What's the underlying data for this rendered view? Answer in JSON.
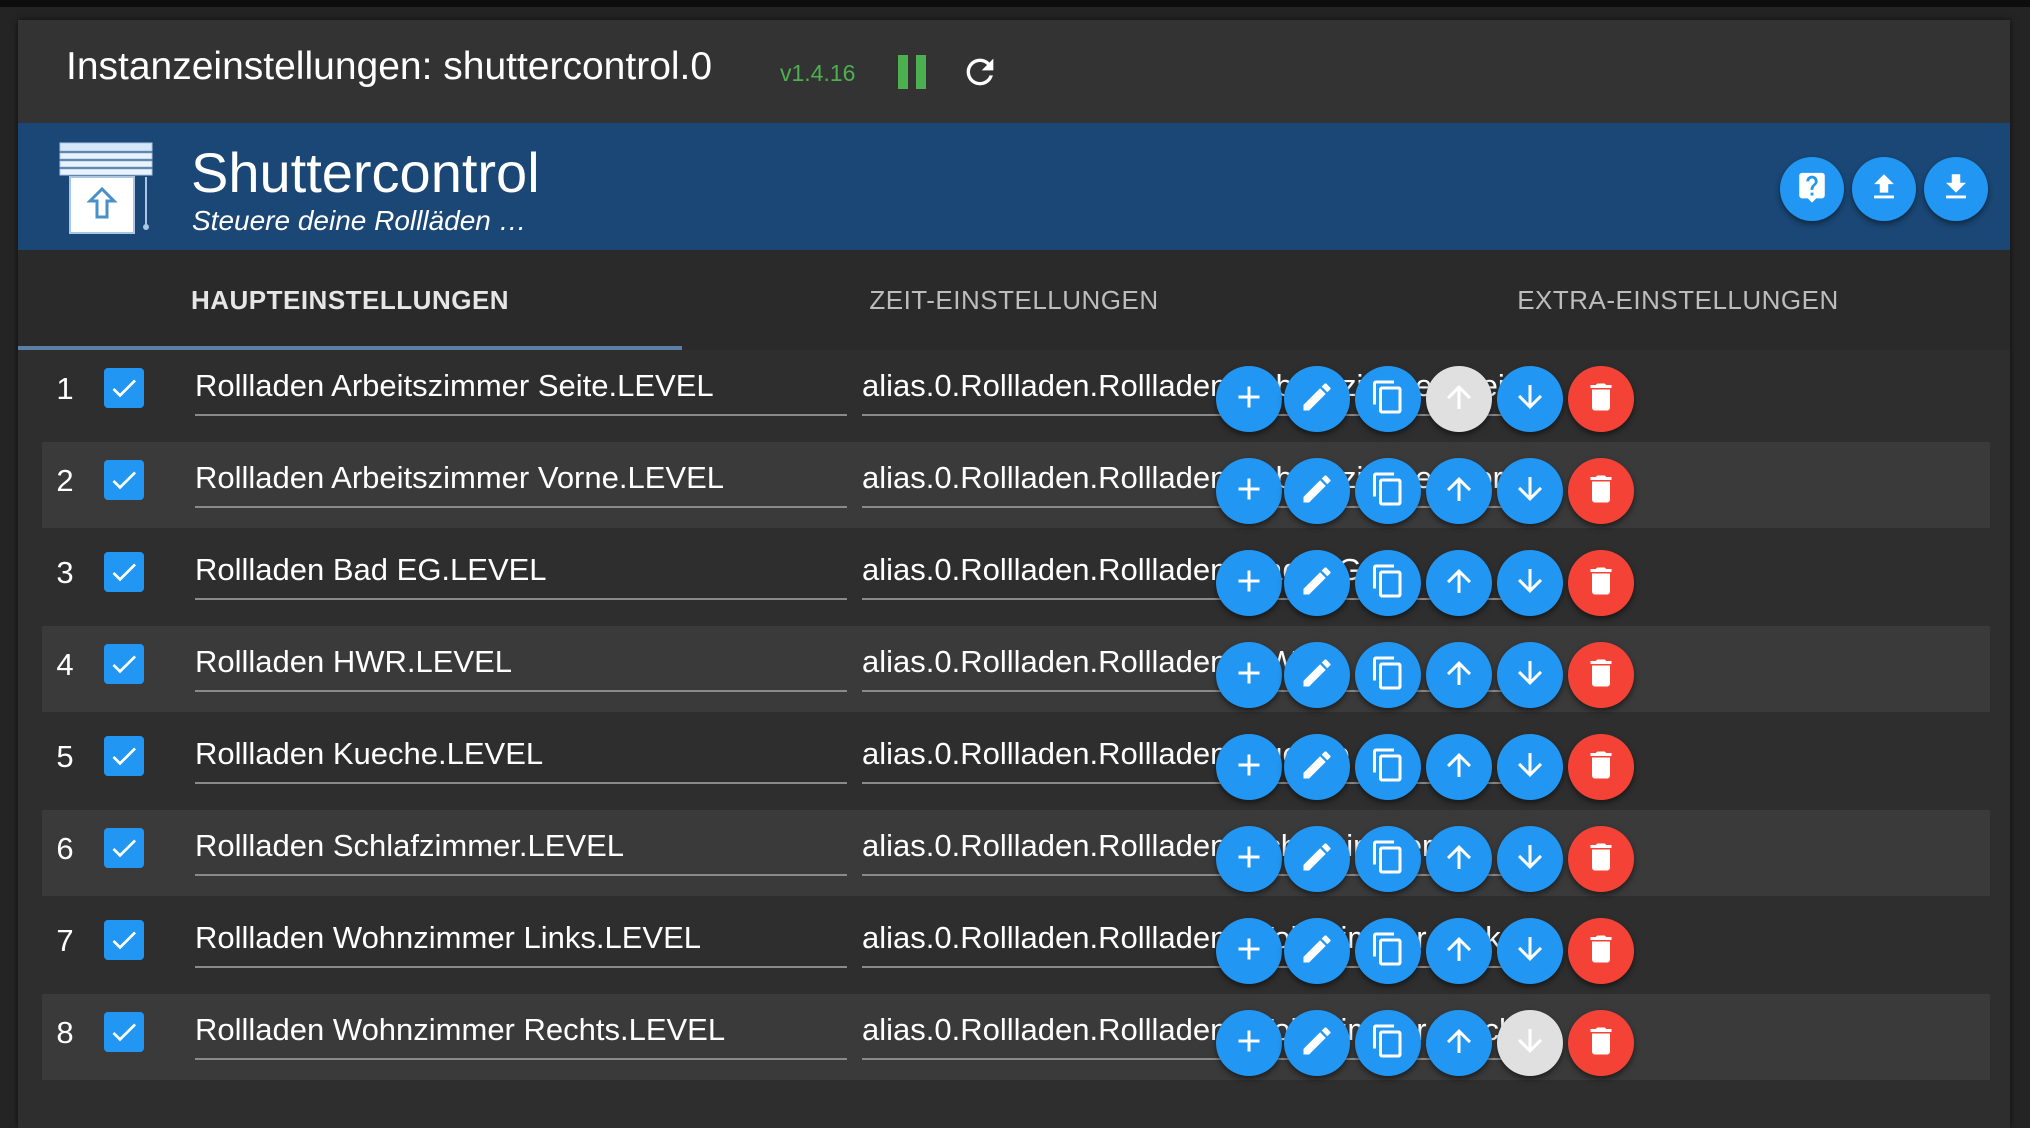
{
  "window": {
    "title": "Instanzeinstellungen: shuttercontrol.0",
    "version": "v1.4.16"
  },
  "adapter": {
    "name": "Shuttercontrol",
    "description": "Steuere deine Rollläden …"
  },
  "tabs": [
    {
      "label": "HAUPTEINSTELLUNGEN",
      "active": true
    },
    {
      "label": "ZEIT-EINSTELLUNGEN",
      "active": false
    },
    {
      "label": "EXTRA-EINSTELLUNGEN",
      "active": false
    }
  ],
  "rows": [
    {
      "num": "1",
      "name": "Rollladen Arbeitszimmer Seite.LEVEL",
      "id": "alias.0.Rollladen.Rollladen_Arbeitszimmer_Seite.LEVEL",
      "checked": true,
      "up_disabled": true,
      "down_disabled": false
    },
    {
      "num": "2",
      "name": "Rollladen Arbeitszimmer Vorne.LEVEL",
      "id": "alias.0.Rollladen.Rollladen_Arbeitszimmer_vorne.LEVEL",
      "checked": true,
      "up_disabled": false,
      "down_disabled": false
    },
    {
      "num": "3",
      "name": "Rollladen Bad EG.LEVEL",
      "id": "alias.0.Rollladen.Rollladen_Bad_EG",
      "checked": true,
      "up_disabled": false,
      "down_disabled": false
    },
    {
      "num": "4",
      "name": "Rollladen HWR.LEVEL",
      "id": "alias.0.Rollladen.Rollladen_HWR",
      "checked": true,
      "up_disabled": false,
      "down_disabled": false
    },
    {
      "num": "5",
      "name": "Rollladen Kueche.LEVEL",
      "id": "alias.0.Rollladen.Rollladen_Kueche",
      "checked": true,
      "up_disabled": false,
      "down_disabled": false
    },
    {
      "num": "6",
      "name": "Rollladen Schlafzimmer.LEVEL",
      "id": "alias.0.Rollladen.Rollladen_Schlafzimmer",
      "checked": true,
      "up_disabled": false,
      "down_disabled": false
    },
    {
      "num": "7",
      "name": "Rollladen Wohnzimmer Links.LEVEL",
      "id": "alias.0.Rollladen.Rollladen_Wohnzimmer_Links.LEVEL",
      "checked": true,
      "up_disabled": false,
      "down_disabled": false
    },
    {
      "num": "8",
      "name": "Rollladen Wohnzimmer Rechts.LEVEL",
      "id": "alias.0.Rollladen.Rollladen_Wohnzimmer_Rechts.LEVEL",
      "checked": true,
      "up_disabled": false,
      "down_disabled": true
    }
  ],
  "colors": {
    "accent": "#2196f3",
    "header": "#1a4775",
    "delete": "#f44336",
    "running": "#4caf50",
    "disabled": "#e0e0e0"
  }
}
